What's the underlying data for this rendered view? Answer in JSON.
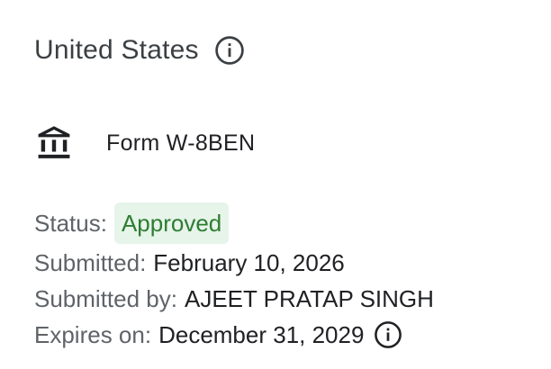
{
  "section": {
    "title": "United States"
  },
  "form": {
    "icon": "bank-icon",
    "name": "Form W-8BEN"
  },
  "details": {
    "status_label": "Status:",
    "status_value": "Approved",
    "status_color": "#2e7d32",
    "status_bg": "#e6f4ea",
    "submitted_label": "Submitted:",
    "submitted_value": "February 10, 2026",
    "submitted_by_label": "Submitted by:",
    "submitted_by_value": "AJEET PRATAP SINGH",
    "expires_label": "Expires on:",
    "expires_value": "December 31, 2029"
  },
  "icons": {
    "header_info": "info-icon",
    "expires_info": "info-icon"
  }
}
